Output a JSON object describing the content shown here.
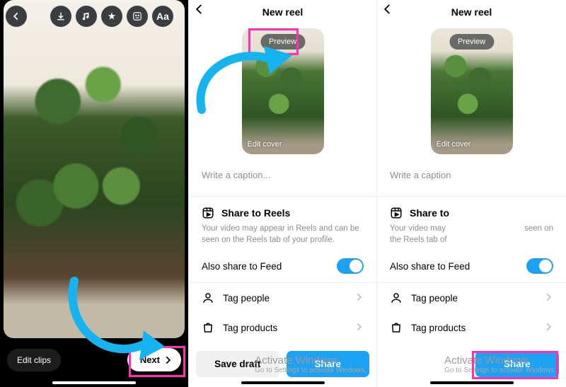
{
  "panel1": {
    "edit_clips": "Edit clips",
    "next": "Next"
  },
  "panel2": {
    "title": "New reel",
    "preview": "Preview",
    "edit_cover": "Edit cover",
    "caption_placeholder": "Write a caption...",
    "share_heading": "Share to Reels",
    "share_sub": "Your video may appear in Reels and can be seen on the Reels tab of your profile.",
    "also_feed": "Also share to Feed",
    "tag_people": "Tag people",
    "tag_products": "Tag products",
    "save_draft": "Save draft",
    "share": "Share"
  },
  "panel3": {
    "title": "New reel",
    "preview": "Preview",
    "edit_cover": "Edit cover",
    "caption_placeholder": "Write a caption",
    "share_heading": "Share to",
    "share_sub_left": "Your video may\nthe Reels tab of",
    "share_sub_right": "seen on",
    "also_feed": "Also share to Feed",
    "tag_people": "Tag people",
    "tag_products": "Tag products",
    "share": "Share"
  },
  "watermark": {
    "title": "Activate Windows",
    "sub": "Go to Settings to activate Windows."
  },
  "colors": {
    "accent": "#1da1f2",
    "highlight": "#ff2fb3",
    "arrow": "#15b4f0"
  }
}
